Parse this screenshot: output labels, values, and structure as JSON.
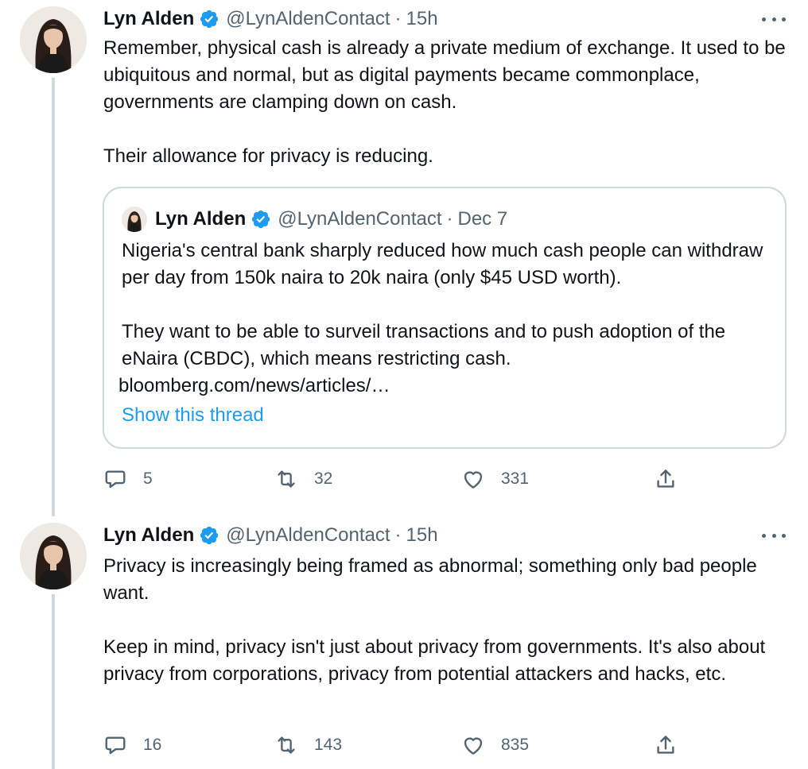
{
  "tweets": [
    {
      "author": {
        "name": "Lyn Alden",
        "handle": "@LynAldenContact",
        "time": "15h",
        "verified": true
      },
      "body": [
        "Remember, physical cash is already a private medium of exchange. It used to be ubiquitous and normal, but as digital payments became commonplace, governments are clamping down on cash.",
        "Their allowance for privacy is reducing."
      ],
      "quote": {
        "author": {
          "name": "Lyn Alden",
          "handle": "@LynAldenContact",
          "time": "Dec 7"
        },
        "body": [
          "Nigeria's central bank sharply reduced how much cash people can withdraw per day from 150k naira to 20k naira (only $45 USD worth).",
          "They want to be able to surveil transactions and to push adoption of the eNaira (CBDC), which means restricting cash."
        ],
        "link": "bloomberg.com/news/articles/…",
        "show_thread": "Show this thread"
      },
      "actions": {
        "replies": "5",
        "retweets": "32",
        "likes": "331"
      }
    },
    {
      "author": {
        "name": "Lyn Alden",
        "handle": "@LynAldenContact",
        "time": "15h",
        "verified": true
      },
      "body": [
        "Privacy is increasingly being framed as abnormal; something only bad people want.",
        "Keep in mind, privacy isn't just about privacy from governments. It's also about privacy from corporations, privacy from potential attackers and hacks, etc."
      ],
      "actions": {
        "replies": "16",
        "retweets": "143",
        "likes": "835"
      }
    }
  ],
  "icons": {
    "verified": "verified-badge-icon",
    "more": "more-icon",
    "reply": "reply-icon",
    "retweet": "retweet-icon",
    "like": "like-icon",
    "share": "share-icon"
  },
  "colors": {
    "accent": "#1d9bf0",
    "secondary_text": "#536471",
    "border": "#cfd9de",
    "text": "#0f1419"
  }
}
